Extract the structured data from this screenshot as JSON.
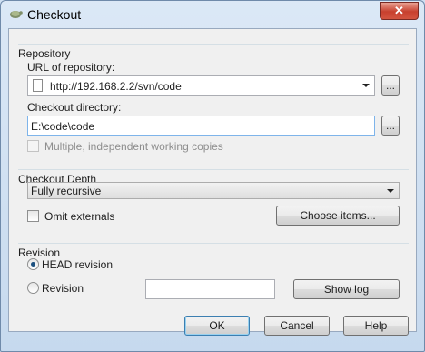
{
  "window": {
    "title": "Checkout",
    "close_label": "✕"
  },
  "repository": {
    "heading": "Repository",
    "url_label": "URL of repository:",
    "url_value": "http://192.168.2.2/svn/code",
    "url_browse_label": "...",
    "dir_label": "Checkout directory:",
    "dir_value": "E:\\code\\code",
    "dir_browse_label": "...",
    "multiple_label": "Multiple, independent working copies",
    "multiple_checked": false
  },
  "depth": {
    "heading": "Checkout Depth",
    "selected": "Fully recursive",
    "omit_label": "Omit externals",
    "omit_checked": false,
    "choose_label": "Choose items..."
  },
  "revision": {
    "heading": "Revision",
    "head_label": "HEAD revision",
    "head_selected": true,
    "revision_label": "Revision",
    "revision_value": "",
    "show_log_label": "Show log"
  },
  "buttons": {
    "ok": "OK",
    "cancel": "Cancel",
    "help": "Help"
  },
  "colors": {
    "accent": "#3c7fb1",
    "close": "#c7402e",
    "dialog_bg": "#f0f0f0"
  }
}
